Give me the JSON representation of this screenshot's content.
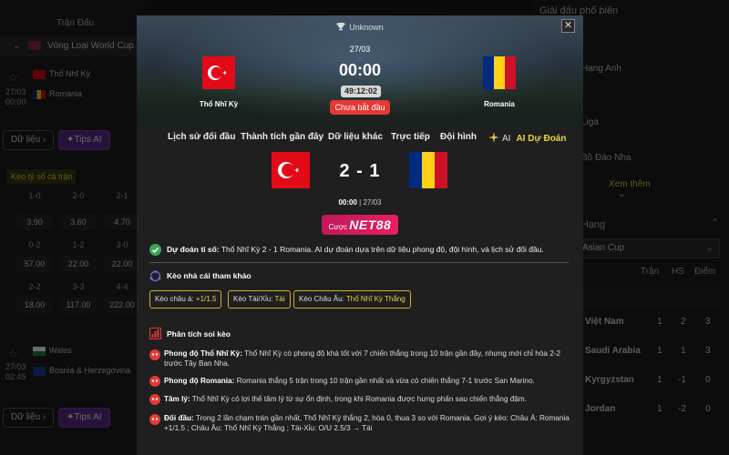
{
  "background": {
    "tabs": [
      "Trận Đấu",
      ""
    ],
    "league_name": "Vòng Loại World Cup Khu",
    "match1": {
      "date": "27/03",
      "time": "00:00",
      "home": "Thổ Nhĩ Kỳ",
      "away": "Romania"
    },
    "match2": {
      "date": "27/03",
      "time": "02:45",
      "home": "Wales",
      "away": "Bosnia & Herzegovina"
    },
    "data_button": "Dữ liệu",
    "tips_button": "Tips AI",
    "odds_title": "Kèo tỷ số cả trận",
    "odds_grid": [
      {
        "label": "1-0",
        "value": "3.90"
      },
      {
        "label": "2-0",
        "value": "3.60"
      },
      {
        "label": "2-1",
        "value": "4.70"
      },
      {
        "label": "0-2",
        "value": "57.00"
      },
      {
        "label": "1-2",
        "value": "22.00"
      },
      {
        "label": "3-0",
        "value": "22.00"
      },
      {
        "label": "2-2",
        "value": "18.00"
      },
      {
        "label": "3-3",
        "value": "117.00"
      },
      {
        "label": "4-4",
        "value": "222.00"
      }
    ],
    "right_title": "Giải đấu phổ biến",
    "right_items": [
      "Hạng Anh",
      "Liga",
      "Bồ Đào Nha"
    ],
    "right_more": "Xem thêm",
    "right_section": "Hạng",
    "select_value": "Asian Cup",
    "table_headers": [
      "Trận",
      "HS",
      "Điểm"
    ],
    "table_rows": [
      {
        "team": "Việt Nam",
        "played": "1",
        "gd": "2",
        "pts": "3"
      },
      {
        "team": "Saudi Arabia",
        "played": "1",
        "gd": "1",
        "pts": "3"
      },
      {
        "team": "Kyrgyzstan",
        "played": "1",
        "gd": "-1",
        "pts": "0"
      },
      {
        "team": "Jordan",
        "played": "1",
        "gd": "-2",
        "pts": "0"
      }
    ]
  },
  "modal": {
    "league": "Unknown",
    "date": "27/03",
    "time": "00:00",
    "countdown": "49:12:02",
    "status": "Chưa bắt đầu",
    "home_team": "Thổ Nhĩ Kỳ",
    "away_team": "Romania",
    "close_label": "✕",
    "tabs": [
      "Lịch sử đối đầu",
      "Thành tích gần đây",
      "Dữ liệu khác",
      "Trực tiếp",
      "Đội hình",
      "AI Dự Đoán"
    ],
    "ai_prefix": "AI",
    "score": "2 - 1",
    "score_time": "00:00",
    "score_date": " | 27/03",
    "sponsor_prefix": "Cược",
    "sponsor_brand": "NET88",
    "prediction_label": "Dự đoán tỉ số:",
    "prediction_text": " Thổ Nhĩ Kỳ 2 - 1 Romania. AI dự đoán dựa trên dữ liệu phong độ, đội hình, và lịch sử đối đầu.",
    "odds_title": "Kèo nhà cái tham khảo",
    "odds": [
      {
        "label": "Kèo châu á: ",
        "value": "+1/1.5"
      },
      {
        "label": "Kèo Tài/Xỉu: ",
        "value": "Tài"
      },
      {
        "label": "Kèo Châu Âu: ",
        "value": "Thổ Nhĩ Kỳ Thắng"
      }
    ],
    "analysis_title": "Phân tích soi kèo",
    "analysis": [
      {
        "label": "Phong độ Thổ Nhĩ Kỳ:",
        "text": " Thổ Nhĩ Kỳ có phong độ khá tốt với 7 chiến thắng trong 10 trận gần đây, nhưng mới chỉ hòa 2-2 trước Tây Ban Nha."
      },
      {
        "label": "Phong độ Romania:",
        "text": " Romania thắng 5 trận trong 10 trận gần nhất và vừa có chiến thắng 7-1 trước San Marino."
      },
      {
        "label": "Tâm lý:",
        "text": " Thổ Nhĩ Kỳ có lợi thế tâm lý từ sự ổn định, trong khi Romania được hưng phấn sau chiến thắng đậm."
      },
      {
        "label": "Đối đầu:",
        "text": " Trong 2 lần chạm trán gần nhất, Thổ Nhĩ Kỳ thắng 2, hòa 0, thua 3 so với Romania. Gợi ý kèo: Châu Á: Romania +1/1.5 ; Châu Âu: Thổ Nhĩ Kỳ Thắng ; Tài-Xỉu: O/U 2.5/3 → Tài"
      }
    ]
  }
}
